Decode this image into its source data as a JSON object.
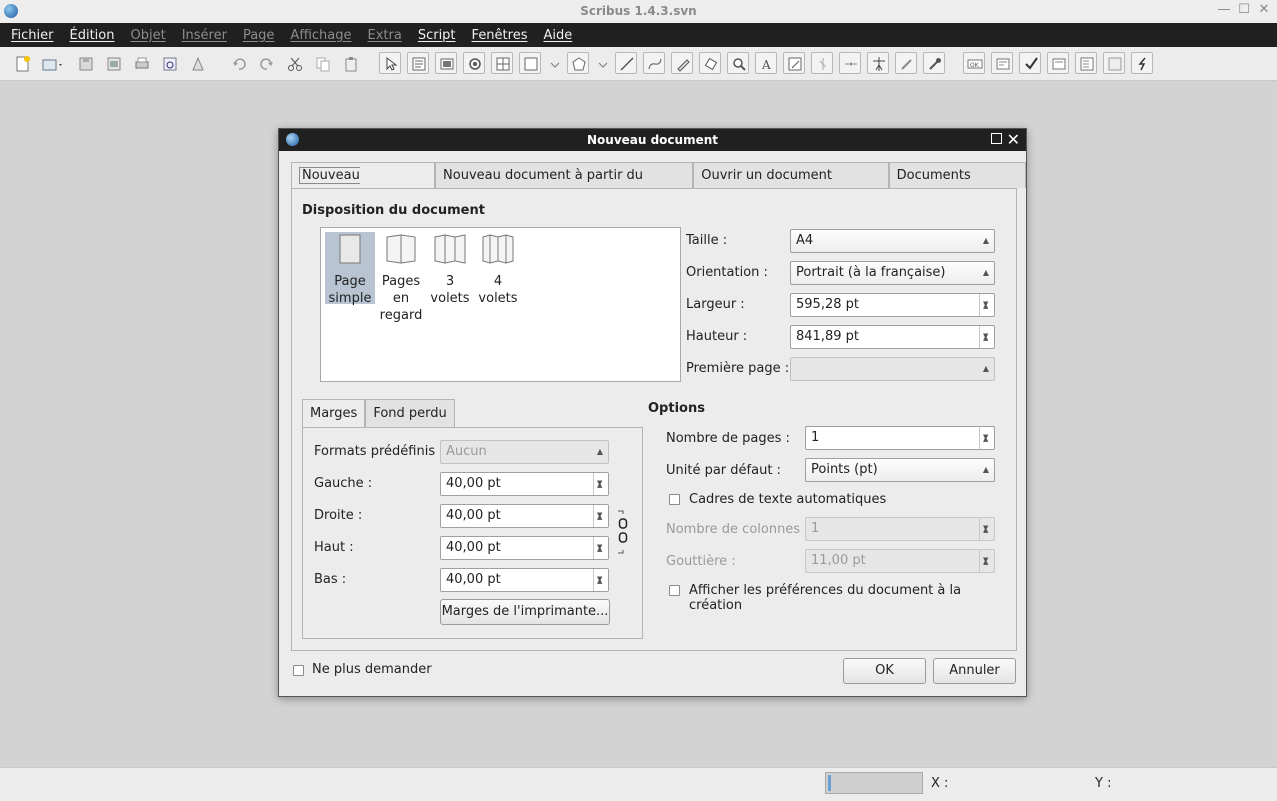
{
  "app": {
    "title": "Scribus 1.4.3.svn"
  },
  "menu": [
    {
      "label": "Fichier",
      "enabled": true
    },
    {
      "label": "Édition",
      "enabled": true
    },
    {
      "label": "Objet",
      "enabled": false
    },
    {
      "label": "Insérer",
      "enabled": false
    },
    {
      "label": "Page",
      "enabled": false
    },
    {
      "label": "Affichage",
      "enabled": false
    },
    {
      "label": "Extra",
      "enabled": false
    },
    {
      "label": "Script",
      "enabled": true
    },
    {
      "label": "Fenêtres",
      "enabled": true
    },
    {
      "label": "Aide",
      "enabled": true
    }
  ],
  "dialog": {
    "title": "Nouveau document",
    "tabs": [
      "Nouveau document",
      "Nouveau document à partir du modèle",
      "Ouvrir un document existant",
      "Documents récents"
    ],
    "layout": {
      "title": "Disposition du document",
      "items": [
        {
          "label1": "Page",
          "label2": "simple",
          "label3": ""
        },
        {
          "label1": "Pages",
          "label2": "en",
          "label3": "regard"
        },
        {
          "label1": "3",
          "label2": "volets",
          "label3": ""
        },
        {
          "label1": "4",
          "label2": "volets",
          "label3": ""
        }
      ]
    },
    "size": {
      "size_label": "Taille :",
      "size_value": "A4",
      "orientation_label": "Orientation :",
      "orientation_value": "Portrait (à la française)",
      "width_label": "Largeur :",
      "width_value": "595,28 pt",
      "height_label": "Hauteur :",
      "height_value": "841,89 pt",
      "first_page_label": "Première page  :",
      "first_page_value": ""
    },
    "margins": {
      "tabs": [
        "Marges",
        "Fond perdu"
      ],
      "preset_label": "Formats prédéfinis :",
      "preset_value": "Aucun",
      "left_label": "Gauche :",
      "left_value": "40,00 pt",
      "right_label": "Droite :",
      "right_value": "40,00 pt",
      "top_label": "Haut :",
      "top_value": "40,00 pt",
      "bottom_label": "Bas :",
      "bottom_value": "40,00 pt",
      "printer_button": "Marges de l'imprimante..."
    },
    "options": {
      "title": "Options",
      "pages_label": "Nombre de pages :",
      "pages_value": "1",
      "unit_label": "Unité par défaut :",
      "unit_value": "Points (pt)",
      "autoframes_label": "Cadres de texte automatiques",
      "columns_label": "Nombre de colonnes :",
      "columns_value": "1",
      "gutter_label": "Gouttière :",
      "gutter_value": "11,00 pt",
      "showprefs_label": "Afficher les préférences du document à la création"
    },
    "dont_ask_label": "Ne plus demander",
    "ok_label": "OK",
    "cancel_label": "Annuler"
  },
  "status": {
    "x_label": "X :",
    "y_label": "Y :"
  }
}
